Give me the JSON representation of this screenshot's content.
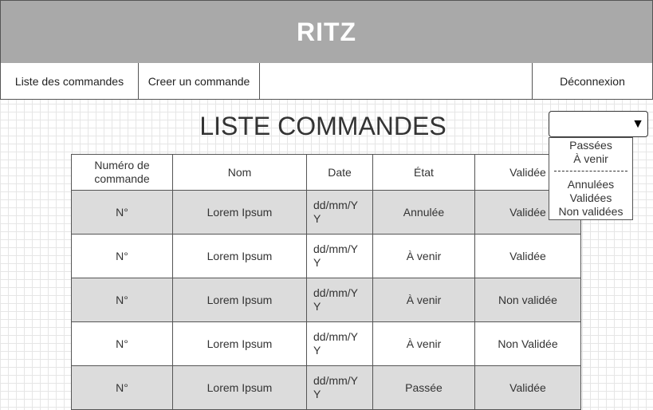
{
  "header": {
    "title": "RITZ"
  },
  "nav": {
    "items": [
      {
        "label": "Liste des commandes"
      },
      {
        "label": "Creer un commande"
      }
    ],
    "logout_label": "Déconnexion"
  },
  "page": {
    "title": "LISTE COMMANDES"
  },
  "filter": {
    "selected": "",
    "arrow": "▼",
    "options_group1": [
      "Passées",
      "À venir"
    ],
    "options_group2": [
      "Annulées",
      "Validées",
      "Non validées"
    ]
  },
  "table": {
    "headers": [
      "Numéro de commande",
      "Nom",
      "Date",
      "État",
      "Validée"
    ],
    "rows": [
      [
        "N°",
        "Lorem Ipsum",
        "dd/mm/YY",
        "Annulée",
        "Validée"
      ],
      [
        "N°",
        "Lorem Ipsum",
        "dd/mm/YY",
        "À venir",
        "Validée"
      ],
      [
        "N°",
        "Lorem Ipsum",
        "dd/mm/YY",
        "À venir",
        "Non validée"
      ],
      [
        "N°",
        "Lorem Ipsum",
        "dd/mm/YY",
        "À venir",
        "Non Validée"
      ],
      [
        "N°",
        "Lorem Ipsum",
        "dd/mm/YY",
        "Passée",
        "Validée"
      ]
    ]
  }
}
